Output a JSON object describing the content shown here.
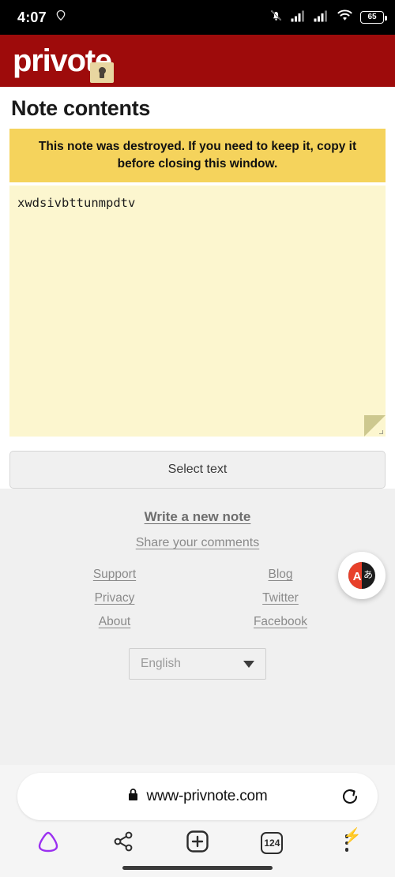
{
  "status_bar": {
    "time": "4:07",
    "location_icon": "location-pin-icon",
    "mute_icon": "bell-muted-icon",
    "signal_icon_1": "cellular-signal-icon",
    "signal_icon_2": "cellular-signal-icon",
    "wifi_icon": "wifi-icon",
    "battery_level": "65"
  },
  "brand": {
    "name_before": "priv",
    "name_after": "ote",
    "full_name": "privnote",
    "lock_icon": "padlock-icon",
    "header_color": "#9E0B0B"
  },
  "page": {
    "title": "Note contents",
    "alert": "This note was destroyed. If you need to keep it, copy it before closing this window.",
    "alert_color": "#F5D35C",
    "note_text": "xwdsivbttunmpdtv",
    "note_bg_color": "#FCF6CF",
    "select_button": "Select text"
  },
  "footer": {
    "write_new_note": "Write a new note",
    "share_comments": "Share your comments",
    "left_links": [
      "Support",
      "Privacy",
      "About"
    ],
    "right_links": [
      "Blog",
      "Twitter",
      "Facebook"
    ],
    "language_selected": "English",
    "translate_fab": "translate-icon",
    "translate_latin_char": "A",
    "translate_japanese_char": "あ"
  },
  "browser": {
    "url": "www-privnote.com",
    "lock_icon": "padlock-secure-icon",
    "reload_icon": "reload-icon",
    "toolbar": {
      "home_icon": "brave-shield-icon",
      "share_icon": "share-icon",
      "newtab_icon": "plus-icon",
      "tab_count": "124",
      "menu_icon": "overflow-menu-icon",
      "bolt_icon": "lightning-bolt-icon"
    }
  }
}
